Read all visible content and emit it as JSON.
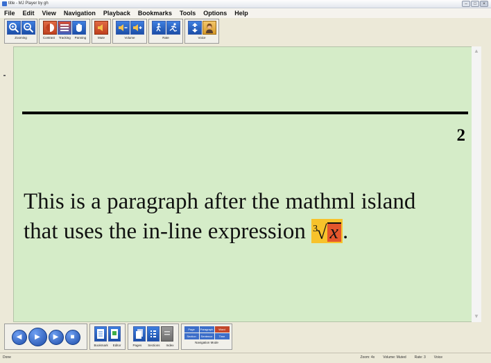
{
  "window": {
    "title": "title - MJ Player by gh"
  },
  "window_controls": {
    "minimize": "–",
    "maximize": "□",
    "close": "×"
  },
  "menu": [
    "File",
    "Edit",
    "View",
    "Navigation",
    "Playback",
    "Bookmarks",
    "Tools",
    "Options",
    "Help"
  ],
  "toolbar": {
    "groups": [
      {
        "label": "Zooming"
      },
      {
        "labels": [
          "Contrast",
          "Tracking",
          "Panning"
        ]
      },
      {
        "label": "Mute"
      },
      {
        "label": "Volume"
      },
      {
        "label": "Rate"
      },
      {
        "label": "Voice"
      }
    ]
  },
  "document": {
    "equation_number": "2",
    "paragraph_line1": "This is a paragraph after the mathml island",
    "paragraph_line2": "that uses the in-line expression",
    "math_index": "3",
    "math_radicand": "x",
    "trailing_period": "."
  },
  "bottom": {
    "labels": [
      "Bookmark",
      "Editor",
      "Pages",
      "Sections",
      "Index"
    ],
    "navigation_modes": [
      "Page",
      "Paragraph",
      "Word",
      "Section",
      "Sentence",
      "Time"
    ],
    "active_mode": "Word",
    "navigation_mode_label": "Navigation Mode"
  },
  "status": {
    "left": "Done",
    "zoom": "Zoom: 4x",
    "volume": "Volume: Muted",
    "rate": "Rate: 3",
    "voice": "Voice"
  },
  "colors": {
    "content_bg": "#d5ecc8",
    "highlight": "#f7c22b",
    "active_word": "#e4562c",
    "button_blue": "#1b4ea8"
  }
}
